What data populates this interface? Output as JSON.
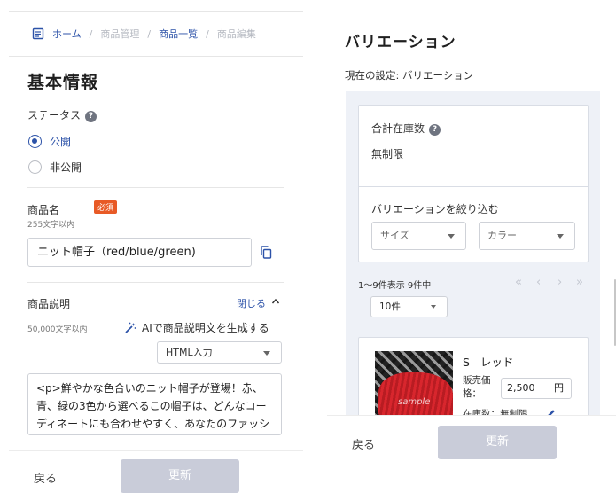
{
  "left": {
    "breadcrumb": {
      "home": "ホーム",
      "product_mgmt": "商品管理",
      "product_list": "商品一覧",
      "product_edit": "商品編集"
    },
    "heading": "基本情報",
    "status": {
      "label": "ステータス",
      "options": [
        "公開",
        "非公開"
      ],
      "selected": "公開"
    },
    "name": {
      "label": "商品名",
      "required_badge": "必須",
      "limit": "255文字以内",
      "value": "ニット帽子（red/blue/green)"
    },
    "description": {
      "label": "商品説明",
      "close_label": "閉じる",
      "limit": "50,000文字以内",
      "ai_label": "AIで商品説明文を生成する",
      "mode": "HTML入力",
      "text": "<p>鮮やかな色合いのニット帽子が登場！赤、青、緑の3色から選べるこの帽子は、どんなコーディネートにも合わせやすく、あなたのファッションにアクセントを加えます。ニット素"
    },
    "footer": {
      "back": "戻る",
      "update": "更新"
    }
  },
  "right": {
    "heading": "バリエーション",
    "current_setting": "現在の設定: バリエーション",
    "total_stock": {
      "label": "合計在庫数",
      "value": "無制限"
    },
    "filter": {
      "label": "バリエーションを絞り込む",
      "size_placeholder": "サイズ",
      "color_placeholder": "カラー"
    },
    "pager": {
      "summary": "1〜9件表示 9件中",
      "per_page": "10件"
    },
    "product": {
      "size": "S",
      "color": "レッド",
      "price_label": "販売価格：",
      "price": "2,500",
      "unit": "円",
      "stock_label": "在庫数：",
      "stock_value": "無制限",
      "image_text": "sample"
    },
    "footer": {
      "back": "戻る",
      "update": "更新"
    }
  },
  "colors": {
    "accent": "#2c52a8",
    "required": "#e85a26",
    "disabled_button": "#c9ccd9",
    "panel_bg": "#eef1f7"
  },
  "icons": [
    "document-icon",
    "help-icon",
    "copy-icon",
    "chevron-up-icon",
    "magic-wand-icon",
    "caret-down-icon",
    "pagination-icons",
    "pencil-icon"
  ]
}
